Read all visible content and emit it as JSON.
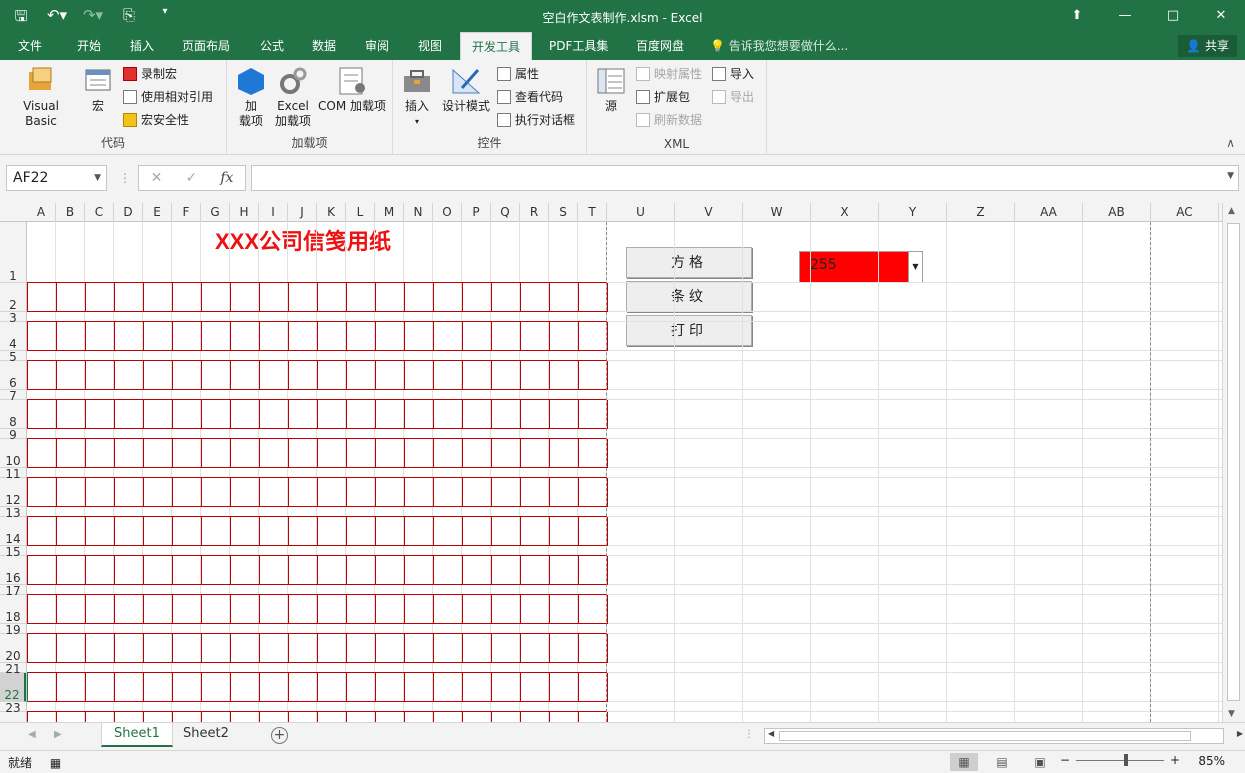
{
  "window": {
    "title": "空白作文表制作.xlsm - Excel"
  },
  "qat": {
    "save_icon": "save-icon",
    "undo_icon": "undo-icon",
    "redo_icon": "redo-icon",
    "preview_icon": "print-preview-icon"
  },
  "tabs": [
    {
      "label": "文件"
    },
    {
      "label": "开始"
    },
    {
      "label": "插入"
    },
    {
      "label": "页面布局"
    },
    {
      "label": "公式"
    },
    {
      "label": "数据"
    },
    {
      "label": "审阅"
    },
    {
      "label": "视图"
    },
    {
      "label": "开发工具"
    },
    {
      "label": "PDF工具集"
    },
    {
      "label": "百度网盘"
    }
  ],
  "tell_me": "告诉我您想要做什么...",
  "share_label": "共享",
  "ribbon": {
    "code": {
      "label": "代码",
      "visual_basic": "Visual Basic",
      "macros": "宏",
      "record_macro": "录制宏",
      "relative_refs": "使用相对引用",
      "macro_security": "宏安全性"
    },
    "addins": {
      "label": "加载项",
      "addins1": "加",
      "addins2": "载项",
      "excel_addins1": "Excel",
      "excel_addins2": "加载项",
      "com_addins": "COM 加载项"
    },
    "controls": {
      "label": "控件",
      "insert": "插入",
      "design_mode": "设计模式",
      "properties": "属性",
      "view_code": "查看代码",
      "run_dialog": "执行对话框"
    },
    "xml": {
      "label": "XML",
      "source": "源",
      "map_props": "映射属性",
      "expansion": "扩展包",
      "refresh": "刷新数据",
      "import": "导入",
      "export": "导出"
    }
  },
  "name_box": "AF22",
  "formula": "",
  "columns": [
    "A",
    "B",
    "C",
    "D",
    "E",
    "F",
    "G",
    "H",
    "I",
    "J",
    "K",
    "L",
    "M",
    "N",
    "O",
    "P",
    "Q",
    "R",
    "S",
    "T",
    "U",
    "V",
    "W",
    "X",
    "Y",
    "Z",
    "AA",
    "AB",
    "AC"
  ],
  "rows": [
    "1",
    "2",
    "3",
    "4",
    "5",
    "6",
    "7",
    "8",
    "9",
    "10",
    "11",
    "12",
    "13",
    "14",
    "15",
    "16",
    "17",
    "18",
    "19",
    "20",
    "21",
    "22",
    "23"
  ],
  "sheet": {
    "title": "XXX公司信笺用纸"
  },
  "form_buttons": {
    "grid": "方格",
    "stripes": "条纹",
    "print": "打印"
  },
  "combo": {
    "value": "255",
    "color": "#ff0000"
  },
  "sheet_tabs": [
    "Sheet1",
    "Sheet2"
  ],
  "status": {
    "ready": "就绪",
    "zoom": "85%"
  },
  "colors": {
    "accent": "#217346",
    "grid_red": "#c00000",
    "title_red": "#ee1111"
  }
}
